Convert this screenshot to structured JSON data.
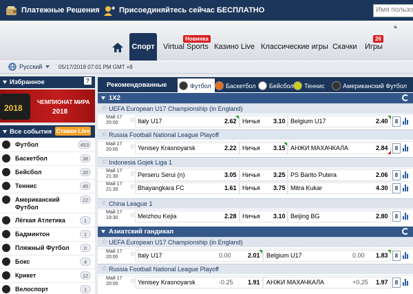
{
  "topbar": {
    "payments": "Платежные Решения",
    "join": "Присоединяйтесь сейчас БЕСПЛАТНО",
    "login_placeholder": "Имя пользов"
  },
  "nav": {
    "sport": "Спорт",
    "virtual": "Virtual Sports",
    "virtual_badge": "Новинка",
    "casino": "Казино Live",
    "classic": "Классические игры",
    "downloads": "Скачки",
    "games": "Игры",
    "games_badge": "26"
  },
  "subbar": {
    "language": "Русский",
    "datetime": "05/17/2018 07:01 PM GMT +8"
  },
  "sidebar": {
    "favorites": "Избранное",
    "favorites_help": "?",
    "banner_line1": "ЧЕМПИОНАТ МИРА",
    "banner_line2": "2018",
    "banner_logo": "2018",
    "all_events": "Все события",
    "live_bets": "Ставки Live",
    "sports": [
      {
        "name": "Футбол",
        "count": "453",
        "icon": "soccer-ball-icon"
      },
      {
        "name": "Баскетбол",
        "count": "38",
        "icon": "basketball-icon"
      },
      {
        "name": "Бейсбол",
        "count": "20",
        "icon": "baseball-icon"
      },
      {
        "name": "Теннис",
        "count": "46",
        "icon": "tennis-icon"
      },
      {
        "name": "Американский",
        "name2": "Футбол",
        "count": "22",
        "icon": "american-football-icon"
      },
      {
        "name": "Лёгкая Атлетика",
        "count": "1",
        "icon": "athletics-icon"
      },
      {
        "name": "Бадминтон",
        "count": "1",
        "icon": "badminton-icon"
      },
      {
        "name": "Пляжный Футбол",
        "count": "0",
        "icon": "beach-soccer-icon"
      },
      {
        "name": "Бокс",
        "count": "4",
        "icon": "boxing-icon"
      },
      {
        "name": "Крикет",
        "count": "12",
        "icon": "cricket-icon"
      },
      {
        "name": "Велоспорт",
        "count": "1",
        "icon": "cycling-icon"
      }
    ]
  },
  "main": {
    "recommended": "Рекомендованные",
    "tabs": [
      "Футбол",
      "Баскетбол",
      "Бейсбол",
      "Теннис",
      "Американский Футбол"
    ],
    "section1": "1X2",
    "section2": "Азиатский гандикап",
    "draw_label": "Ничья",
    "competitions": [
      "UEFA European U17 Championship (in England)",
      "Russia Football National League Playoff",
      "Indonesia Gojek Liga 1",
      "China League 1",
      "UEFA European U17 Championship (in England)",
      "Russia Football National League Playoff"
    ],
    "matches_1x2": [
      {
        "date": "Май 17",
        "time": "20:00",
        "home": "Italy U17",
        "h": "2.62",
        "d": "3.10",
        "away": "Belgium U17",
        "a": "2.40",
        "markets": "8"
      },
      {
        "date": "Май 17",
        "time": "20:00",
        "home": "Yenisey Krasnoyarsk",
        "h": "2.22",
        "d": "3.15",
        "away": "АНЖИ МАХАЧКАЛА",
        "a": "2.84",
        "markets": "8"
      },
      {
        "date": "Май 17",
        "time": "21:30",
        "home": "Perseru Serui (n)",
        "h": "3.05",
        "d": "3.25",
        "away": "PS Barito Putera",
        "a": "2.06",
        "markets": "8"
      },
      {
        "date": "Май 17",
        "time": "21:30",
        "home": "Bhayangkara FC",
        "h": "1.61",
        "d": "3.75",
        "away": "Mitra Kukar",
        "a": "4.30",
        "markets": "8"
      },
      {
        "date": "Май 17",
        "time": "19:30",
        "home": "Meizhou Kejia",
        "h": "2.28",
        "d": "3.10",
        "away": "Beijing BG",
        "a": "2.80",
        "markets": "8"
      }
    ],
    "matches_ah": [
      {
        "date": "Май 17",
        "time": "20:00",
        "home": "Italy U17",
        "hh": "0.00",
        "h": "2.01",
        "away": "Belgium U17",
        "ha": "0.00",
        "a": "1.83",
        "markets": "8"
      },
      {
        "date": "Май 17",
        "time": "20:00",
        "home": "Yenisey Krasnoyarsk",
        "hh": "-0.25",
        "h": "1.91",
        "away": "АНЖИ МАХАЧКАЛА",
        "ha": "+0.25",
        "a": "1.97",
        "markets": "8"
      }
    ]
  },
  "colors": {
    "navy": "#1b355b",
    "section": "#34578a",
    "live": "#f3a02a",
    "badge": "#d81e1e"
  }
}
